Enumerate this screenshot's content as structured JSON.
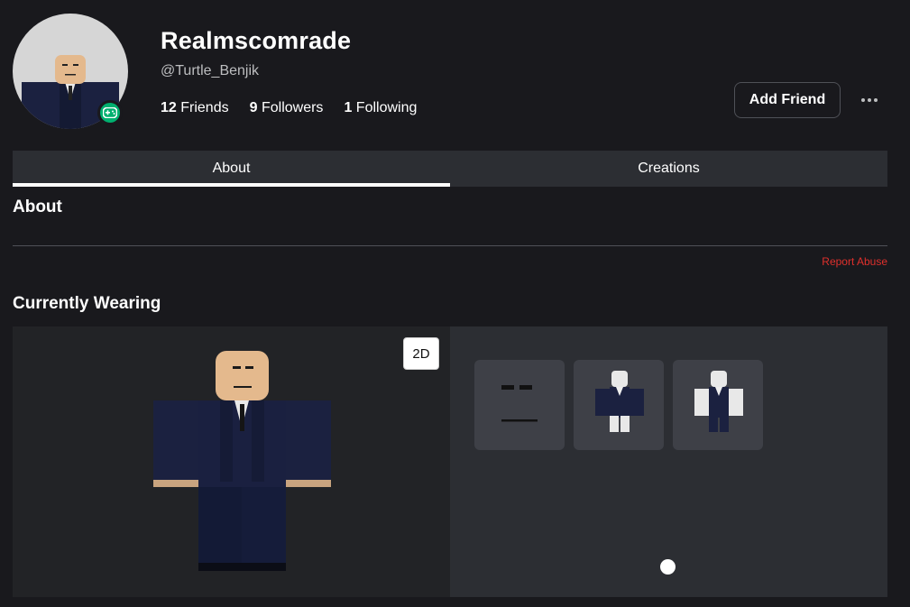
{
  "profile": {
    "display_name": "Realmscomrade",
    "username": "@Turtle_Benjik",
    "stats": [
      {
        "count": "12",
        "label": "Friends"
      },
      {
        "count": "9",
        "label": "Followers"
      },
      {
        "count": "1",
        "label": "Following"
      }
    ]
  },
  "actions": {
    "add_friend_label": "Add Friend"
  },
  "tabs": [
    {
      "label": "About",
      "active": true
    },
    {
      "label": "Creations",
      "active": false
    }
  ],
  "about": {
    "heading": "About",
    "report_label": "Report Abuse"
  },
  "wearing": {
    "heading": "Currently Wearing",
    "toggle_label": "2D",
    "items": [
      {
        "icon": "face-icon"
      },
      {
        "icon": "suit-shirt-icon"
      },
      {
        "icon": "suit-pants-icon"
      }
    ],
    "page_count": 1,
    "current_page": 1
  },
  "colors": {
    "background": "#19191d",
    "panel": "#2c2e33",
    "online_status": "#00b06f",
    "report": "#e0302c",
    "suit": "#1b2140",
    "skin": "#e4b98d"
  }
}
